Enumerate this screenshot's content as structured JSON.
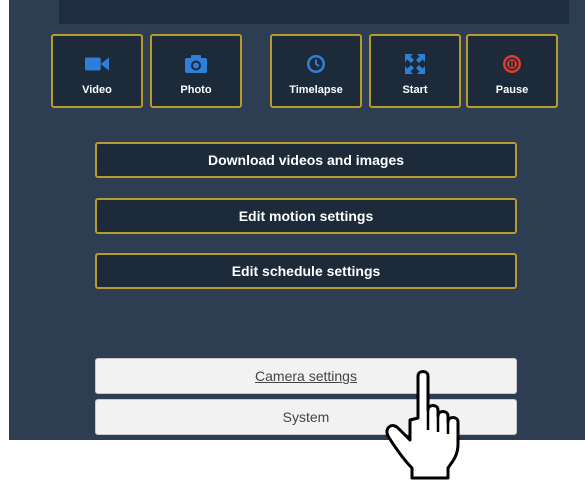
{
  "mode_buttons": [
    {
      "label": "Video",
      "icon": "video-camera-icon",
      "color": "#2f7fd9"
    },
    {
      "label": "Photo",
      "icon": "camera-icon",
      "color": "#2f7fd9"
    },
    {
      "label": "Timelapse",
      "icon": "clock-icon",
      "color": "#2f7fd9"
    },
    {
      "label": "Start",
      "icon": "expand-arrows-icon",
      "color": "#2f7fd9"
    },
    {
      "label": "Pause",
      "icon": "pause-circle-icon",
      "color": "#e03a2a"
    }
  ],
  "actions": {
    "download": "Download videos and images",
    "motion": "Edit motion settings",
    "schedule": "Edit schedule settings"
  },
  "settings": {
    "camera": "Camera settings",
    "system": "System"
  },
  "colors": {
    "panel": "#2d3e52",
    "button_bg": "#1c2a3a",
    "button_border": "#b99a2e",
    "accent_blue": "#2f7fd9",
    "accent_red": "#e03a2a"
  },
  "cursor": "hand-pointer-icon"
}
